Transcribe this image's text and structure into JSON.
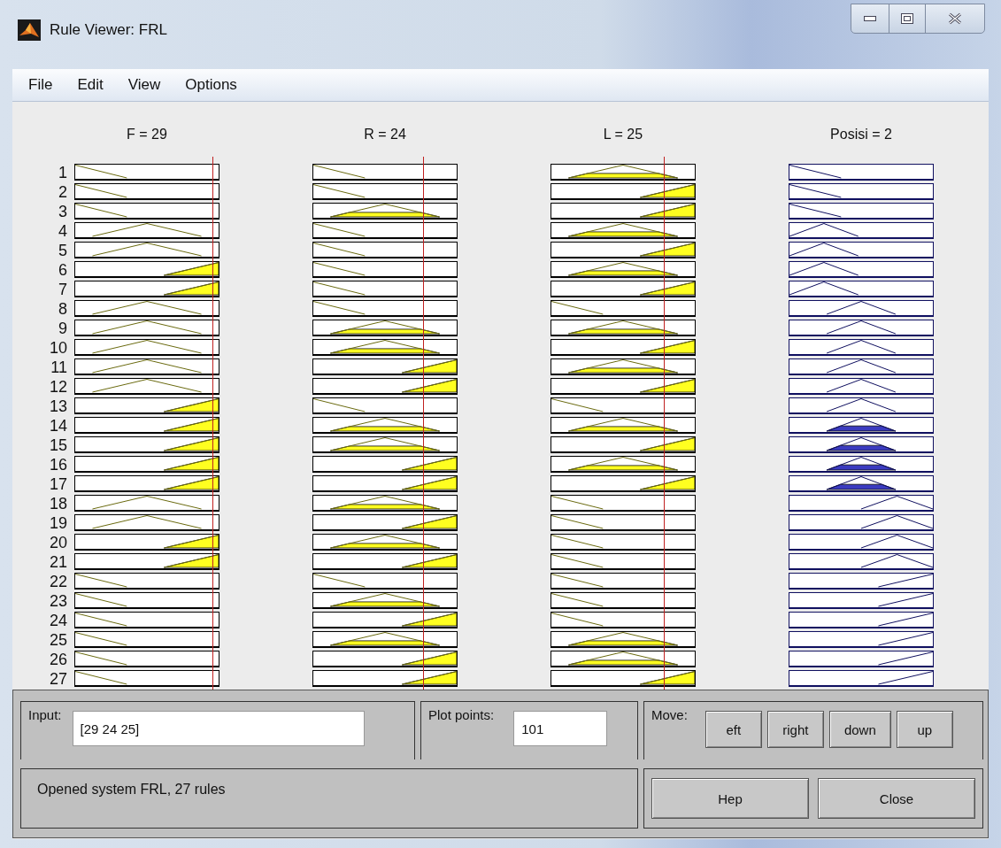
{
  "window": {
    "title": "Rule Viewer: FRL"
  },
  "menu": [
    "File",
    "Edit",
    "View",
    "Options"
  ],
  "rule_numbers": [
    "1",
    "2",
    "3",
    "4",
    "5",
    "6",
    "7",
    "8",
    "9",
    "10",
    "11",
    "12",
    "13",
    "14",
    "15",
    "16",
    "17",
    "18",
    "19",
    "20",
    "21",
    "22",
    "23",
    "24",
    "25",
    "26",
    "27"
  ],
  "columns": [
    {
      "label": "F = 29",
      "kind": "input",
      "rules": [
        {
          "kind": "z",
          "fired": false
        },
        {
          "kind": "z",
          "fired": false
        },
        {
          "kind": "z",
          "fired": false
        },
        {
          "kind": "t",
          "fired": false
        },
        {
          "kind": "t",
          "fired": false
        },
        {
          "kind": "s",
          "fired": true
        },
        {
          "kind": "s",
          "fired": true
        },
        {
          "kind": "t",
          "fired": false
        },
        {
          "kind": "t",
          "fired": false
        },
        {
          "kind": "t",
          "fired": false
        },
        {
          "kind": "t",
          "fired": false
        },
        {
          "kind": "t",
          "fired": false
        },
        {
          "kind": "s",
          "fired": true
        },
        {
          "kind": "s",
          "fired": true
        },
        {
          "kind": "s",
          "fired": true
        },
        {
          "kind": "s",
          "fired": true
        },
        {
          "kind": "s",
          "fired": true
        },
        {
          "kind": "t",
          "fired": false
        },
        {
          "kind": "t",
          "fired": false
        },
        {
          "kind": "s",
          "fired": true
        },
        {
          "kind": "s",
          "fired": true
        },
        {
          "kind": "z",
          "fired": false
        },
        {
          "kind": "z",
          "fired": false
        },
        {
          "kind": "z",
          "fired": false
        },
        {
          "kind": "z",
          "fired": false
        },
        {
          "kind": "z",
          "fired": false
        },
        {
          "kind": "z",
          "fired": false
        }
      ]
    },
    {
      "label": "R = 24",
      "kind": "input",
      "rules": [
        {
          "kind": "z",
          "fired": false
        },
        {
          "kind": "z",
          "fired": false
        },
        {
          "kind": "t",
          "fired": true
        },
        {
          "kind": "z",
          "fired": false
        },
        {
          "kind": "z",
          "fired": false
        },
        {
          "kind": "z",
          "fired": false
        },
        {
          "kind": "z",
          "fired": false
        },
        {
          "kind": "z",
          "fired": false
        },
        {
          "kind": "t",
          "fired": true
        },
        {
          "kind": "t",
          "fired": true
        },
        {
          "kind": "s",
          "fired": true
        },
        {
          "kind": "s",
          "fired": true
        },
        {
          "kind": "z",
          "fired": false
        },
        {
          "kind": "t",
          "fired": true
        },
        {
          "kind": "t",
          "fired": true
        },
        {
          "kind": "s",
          "fired": true
        },
        {
          "kind": "s",
          "fired": true
        },
        {
          "kind": "t",
          "fired": true
        },
        {
          "kind": "s",
          "fired": true
        },
        {
          "kind": "t",
          "fired": true
        },
        {
          "kind": "s",
          "fired": true
        },
        {
          "kind": "z",
          "fired": false
        },
        {
          "kind": "t",
          "fired": true
        },
        {
          "kind": "s",
          "fired": true
        },
        {
          "kind": "t",
          "fired": true
        },
        {
          "kind": "s",
          "fired": true
        },
        {
          "kind": "s",
          "fired": true
        }
      ]
    },
    {
      "label": "L = 25",
      "kind": "input",
      "rules": [
        {
          "kind": "t",
          "fired": true
        },
        {
          "kind": "s",
          "fired": true
        },
        {
          "kind": "s",
          "fired": true
        },
        {
          "kind": "t",
          "fired": true
        },
        {
          "kind": "s",
          "fired": true
        },
        {
          "kind": "t",
          "fired": true
        },
        {
          "kind": "s",
          "fired": true
        },
        {
          "kind": "z",
          "fired": false
        },
        {
          "kind": "t",
          "fired": true
        },
        {
          "kind": "s",
          "fired": true
        },
        {
          "kind": "t",
          "fired": true
        },
        {
          "kind": "s",
          "fired": true
        },
        {
          "kind": "z",
          "fired": false
        },
        {
          "kind": "t",
          "fired": true
        },
        {
          "kind": "s",
          "fired": true
        },
        {
          "kind": "t",
          "fired": true
        },
        {
          "kind": "s",
          "fired": true
        },
        {
          "kind": "z",
          "fired": false
        },
        {
          "kind": "z",
          "fired": false
        },
        {
          "kind": "z",
          "fired": false
        },
        {
          "kind": "z",
          "fired": false
        },
        {
          "kind": "z",
          "fired": false
        },
        {
          "kind": "z",
          "fired": false
        },
        {
          "kind": "z",
          "fired": false
        },
        {
          "kind": "t",
          "fired": true
        },
        {
          "kind": "t",
          "fired": true
        },
        {
          "kind": "s",
          "fired": true
        }
      ]
    },
    {
      "label": "Posisi = 2",
      "kind": "output",
      "rules": [
        {
          "kind": "z",
          "fired": false
        },
        {
          "kind": "z",
          "fired": false
        },
        {
          "kind": "z",
          "fired": false
        },
        {
          "kind": "t-left",
          "fired": false
        },
        {
          "kind": "t-left",
          "fired": false
        },
        {
          "kind": "t-left",
          "fired": false
        },
        {
          "kind": "t-left",
          "fired": false
        },
        {
          "kind": "t-mid",
          "fired": false
        },
        {
          "kind": "t-mid",
          "fired": false
        },
        {
          "kind": "t-mid",
          "fired": false
        },
        {
          "kind": "t-mid",
          "fired": false
        },
        {
          "kind": "t-mid",
          "fired": false
        },
        {
          "kind": "t-mid",
          "fired": false
        },
        {
          "kind": "t-mid",
          "fired": true
        },
        {
          "kind": "t-mid",
          "fired": true
        },
        {
          "kind": "t-mid",
          "fired": true
        },
        {
          "kind": "t-mid",
          "fired": true
        },
        {
          "kind": "t-right",
          "fired": false
        },
        {
          "kind": "t-right",
          "fired": false
        },
        {
          "kind": "t-right",
          "fired": false
        },
        {
          "kind": "t-right",
          "fired": false
        },
        {
          "kind": "s",
          "fired": false
        },
        {
          "kind": "s",
          "fired": false
        },
        {
          "kind": "s",
          "fired": false
        },
        {
          "kind": "s",
          "fired": false
        },
        {
          "kind": "s",
          "fired": false
        },
        {
          "kind": "s",
          "fired": false
        }
      ]
    }
  ],
  "input": {
    "label": "Input:",
    "value": "[29 24 25]"
  },
  "plot_points": {
    "label": "Plot points:",
    "value": "101"
  },
  "move": {
    "label": "Move:",
    "buttons": [
      "eft",
      "right",
      "down",
      "up"
    ]
  },
  "status": "Opened system FRL, 27 rules",
  "buttons": [
    "Hep",
    "Close"
  ]
}
